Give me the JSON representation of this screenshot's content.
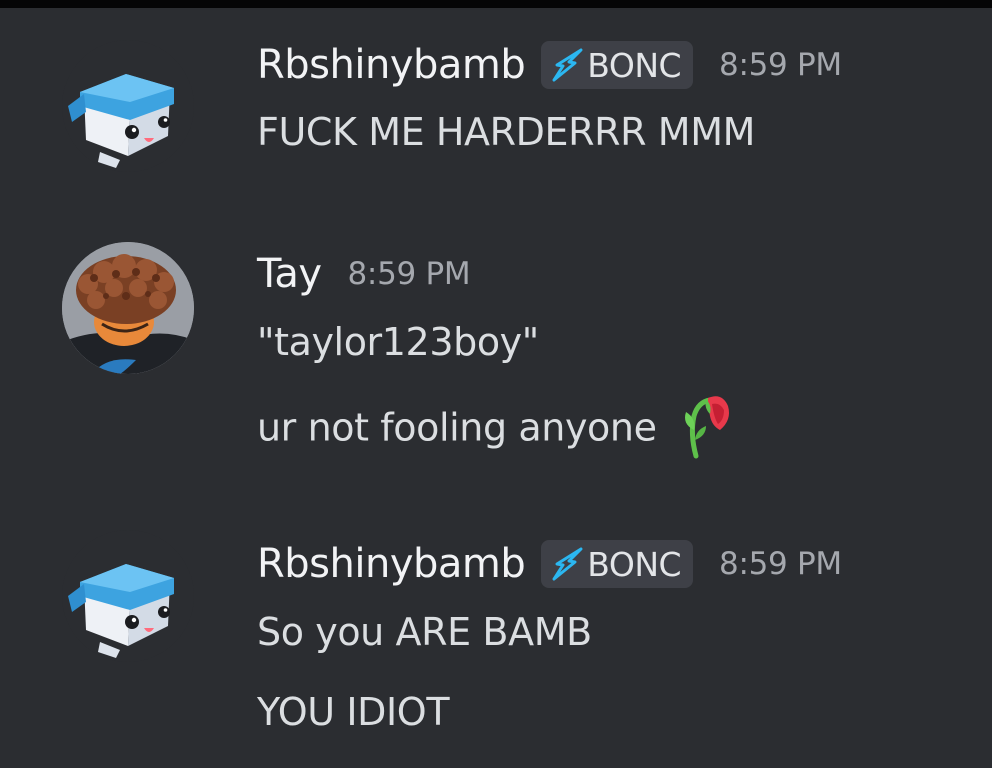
{
  "messages": [
    {
      "author": "Rbshinybamb",
      "avatar_icon": "cube-mascot-avatar",
      "tag": {
        "icon": "lightning-bolt-icon",
        "label": "BONC"
      },
      "time": "8:59 PM",
      "lines": [
        "FUCK ME HARDERRR MMM"
      ]
    },
    {
      "author": "Tay",
      "avatar_icon": "curly-hair-avatar",
      "time": "8:59 PM",
      "lines": [
        "\"taylor123boy\"",
        "ur not fooling anyone"
      ],
      "reaction_emoji": "wilted-flower-emoji"
    },
    {
      "author": "Rbshinybamb",
      "avatar_icon": "cube-mascot-avatar",
      "tag": {
        "icon": "lightning-bolt-icon",
        "label": "BONC"
      },
      "time": "8:59 PM",
      "lines": [
        "So you ARE BAMB",
        "YOU IDIOT"
      ]
    }
  ],
  "colors": {
    "background": "#2b2d31",
    "username": "#f2f3f5",
    "message_text": "#dbdee1",
    "timestamp": "#a5a8ae",
    "tag_background": "#3e4047",
    "bolt": "#2bb7f1"
  }
}
